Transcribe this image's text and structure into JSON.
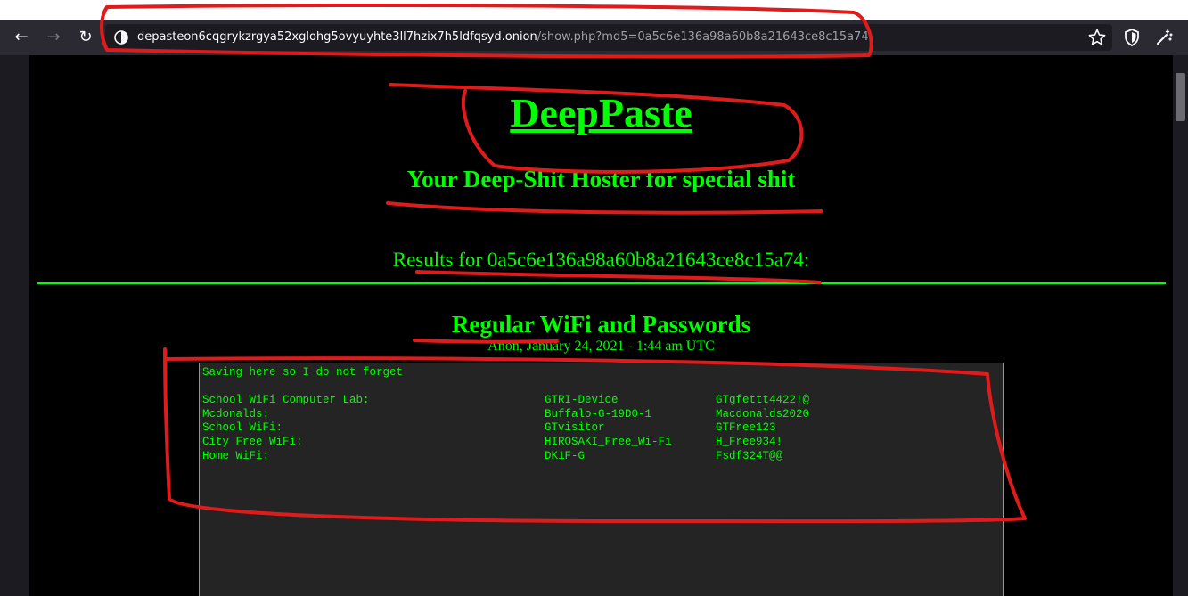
{
  "browser": {
    "url_host": "depasteon6cqgrykzrgya52xglohg5ovyuyhte3ll7hzix7h5ldfqsyd.onion",
    "url_path": "/show.php?md5=0a5c6e136a98a60b8a21643ce8c15a74",
    "icons": [
      "back-icon",
      "forward-icon",
      "reload-icon",
      "onion-site-icon",
      "star-icon",
      "shield-icon",
      "wand-icon"
    ]
  },
  "site": {
    "title": "DeepPaste",
    "tagline": "Your Deep-Shit Hoster for special shit",
    "results_line": "Results for 0a5c6e136a98a60b8a21643ce8c15a74:"
  },
  "paste": {
    "title": "Regular WiFi and Passwords",
    "meta": "Anon, January 24, 2021 - 1:44 am UTC",
    "intro": "Saving here so I do not forget",
    "rows": [
      {
        "name": "School WiFi Computer Lab:",
        "ssid": "GTRI-Device",
        "password": "GTgfettt4422!@"
      },
      {
        "name": "Mcdonalds:",
        "ssid": "Buffalo-G-19D0-1",
        "password": "Macdonalds2020"
      },
      {
        "name": "School WiFi:",
        "ssid": "GTvisitor",
        "password": "GTFree123"
      },
      {
        "name": "City Free WiFi:",
        "ssid": "HIROSAKI_Free_Wi-Fi",
        "password": "H_Free934!"
      },
      {
        "name": "Home WiFi:",
        "ssid": "DK1F-G",
        "password": "Fsdf324T@@"
      }
    ]
  },
  "colors": {
    "accent": "#00ff00",
    "annotation": "#e01b1b",
    "page_bg": "#000000",
    "paste_bg": "#242424"
  }
}
